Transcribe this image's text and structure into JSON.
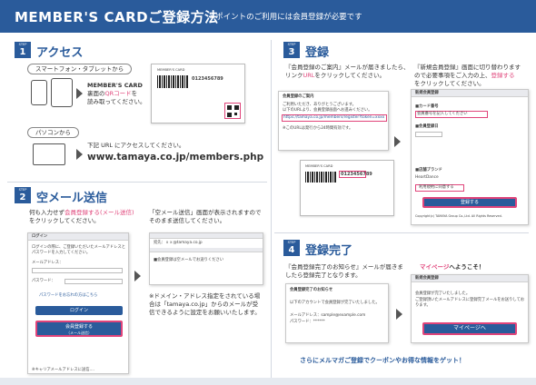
{
  "header": {
    "title": "MEMBER'S CARDご登録方法",
    "subtitle": "※ポイントのご利用には会員登録が必要です"
  },
  "steps": [
    {
      "tag": "STEP",
      "num": "1",
      "title": "アクセス"
    },
    {
      "tag": "STEP",
      "num": "2",
      "title": "空メール送信"
    },
    {
      "tag": "STEP",
      "num": "3",
      "title": "登録"
    },
    {
      "tag": "STEP",
      "num": "4",
      "title": "登録完了"
    }
  ],
  "step1": {
    "smartphone_pill": "スマートフォン・タブレットから",
    "card_text_1": "MEMBER'S CARD",
    "card_text_2_pre": "裏面の",
    "card_text_2_qr": "QRコード",
    "card_text_2_post": "を",
    "card_text_3": "読み取ってください。",
    "pc_pill": "パソコンから",
    "pc_text": "下記 URL にアクセスしてください。",
    "url": "www.tamaya.co.jp/members.php",
    "card_label": "MEMBER'S CARD",
    "card_number": "0123456789"
  },
  "step2": {
    "instruction_pre": "何も入力せず",
    "instruction_link": "会員登録する(メール送信)",
    "instruction_post": "をクリックしてください。",
    "result": "「空メール送信」画面が表示されますのでそのまま送信してください。",
    "login_screen": {
      "title": "ログイン",
      "desc": "ログインの際に、ご登録いただいたメールアドレスとパスワードを入力してください。",
      "email_label": "メールアドレス：",
      "password_label": "パスワード：",
      "forgot_link": "パスワードをお忘れの方はこちら",
      "login_button": "ログイン",
      "register_button": "会員登録する",
      "register_sub": "（メール送信）",
      "note": "※キャリアメールアドレスに送信...."
    },
    "mail_screen": {
      "to": "宛先：ｘｘ@tamaya.co.jp",
      "body": "■会員登録は空メールでお送りください"
    },
    "note": "※ドメイン・アドレス指定をされている場合は「tamaya.co.jp」からのメールが受信できるように設定をお願いいたします。"
  },
  "step3": {
    "left_text_1": "『会員登録のご案内』メールが届きましたら、",
    "left_text_2_pre": "リンク",
    "left_text_2_url": "URL",
    "left_text_2_post": "をクリックしてください。",
    "right_text_1": "『新規会員登録』画面に切り替わります",
    "right_text_2_pre": "ので必要事項をご入力の上、",
    "right_text_2_link": "登録する",
    "right_text_3": "をクリックしてください。",
    "mail": {
      "heading": "会員登録のご案内",
      "line1": "ご利用いただき、ありがとうございます。",
      "line2": "以下のURLより、会員登録画面へお進みください。",
      "link": "https://tamaya.co.jp/members/register?token=xxxx",
      "line3": "※このURLは発行から24時間有効です。"
    },
    "form": {
      "heading": "新規会員登録",
      "card_label": "■カード番号",
      "card_hint": "会員番号を記入してください",
      "date_label": "■会員登録日",
      "brand_label": "■店舗ブランド",
      "brand_value": "HeartDance",
      "agree": "利用規約に同意する",
      "submit": "登録する",
      "copyright": "Copyright(c) TAMAYA Group Co.,Ltd. All Rights Reserved."
    },
    "card_number": "0123456789"
  },
  "step4": {
    "left_text": "『会員登録完了のお知らせ』メールが届きましたら登録完了となります。",
    "right_title_brand": "マイページ",
    "right_title_rest": "へようこそ！",
    "mail": {
      "heading": "会員登録完了のお知らせ",
      "line1": "以下のアカウントで会員登録が完了いたしました。",
      "email_label": "メールアドレス：sample@example.com",
      "password_label": "パスワード：******"
    },
    "page": {
      "heading": "新規会員登録",
      "line1": "会員登録が完了いたしました。",
      "line2": "ご登録頂いたメールアドレスに登録完了メールをお送りしております。",
      "button": "マイページへ"
    }
  },
  "footer": "さらにメルマガご登録でクーポンやお得な情報をゲット！"
}
